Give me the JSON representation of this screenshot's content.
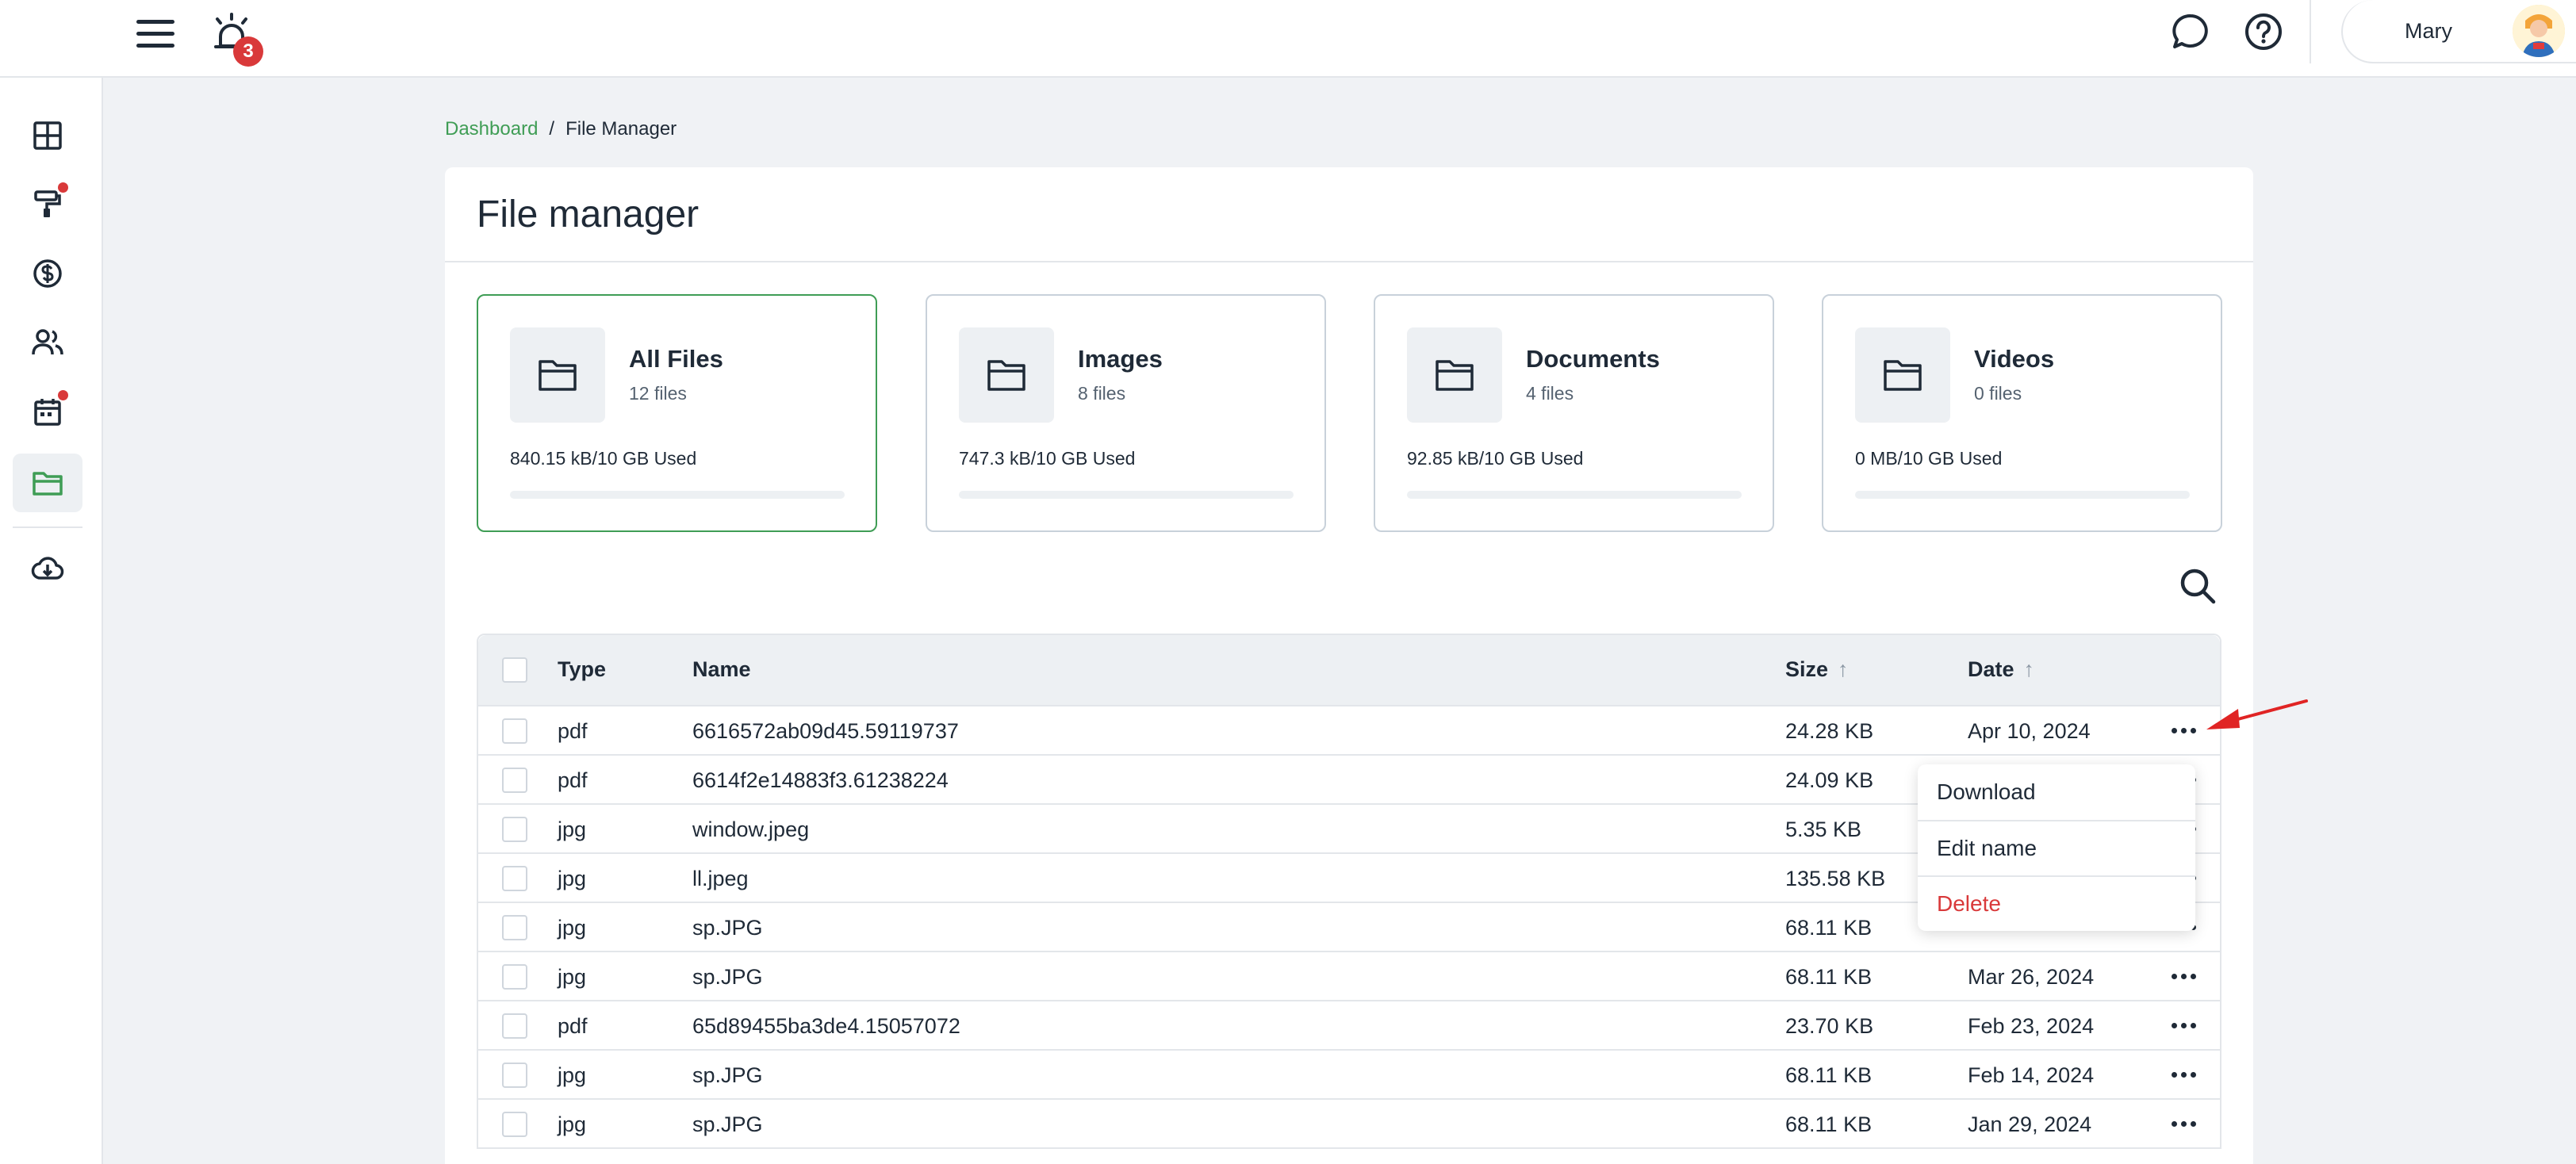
{
  "topbar": {
    "notification_count": "3",
    "user_name": "Mary",
    "icons": [
      "menu-icon",
      "alarm-icon",
      "chat-icon",
      "help-icon"
    ]
  },
  "sidebar": {
    "items": [
      {
        "icon": "dashboard-icon",
        "has_alert": false,
        "active": false
      },
      {
        "icon": "paint-roller-icon",
        "has_alert": true,
        "active": false
      },
      {
        "icon": "dollar-icon",
        "has_alert": false,
        "active": false
      },
      {
        "icon": "users-icon",
        "has_alert": false,
        "active": false
      },
      {
        "icon": "calendar-icon",
        "has_alert": true,
        "active": false
      },
      {
        "icon": "folder-icon",
        "has_alert": false,
        "active": true
      },
      {
        "icon": "cloud-download-icon",
        "has_alert": false,
        "active": false
      }
    ]
  },
  "breadcrumb": {
    "link": "Dashboard",
    "separator": "/",
    "current": "File Manager"
  },
  "page": {
    "title": "File manager"
  },
  "stats": [
    {
      "title": "All Files",
      "count": "12 files",
      "used": "840.15 kB/10 GB Used",
      "usage_fraction": 0.0
    },
    {
      "title": "Images",
      "count": "8 files",
      "used": "747.3 kB/10 GB Used",
      "usage_fraction": 0.0
    },
    {
      "title": "Documents",
      "count": "4 files",
      "used": "92.85 kB/10 GB Used",
      "usage_fraction": 0.0
    },
    {
      "title": "Videos",
      "count": "0 files",
      "used": "0 MB/10 GB Used",
      "usage_fraction": 0.0
    }
  ],
  "table": {
    "headers": {
      "type": "Type",
      "name": "Name",
      "size": "Size",
      "date": "Date"
    },
    "rows": [
      {
        "type": "pdf",
        "name": "6616572ab09d45.59119737",
        "size": "24.28 KB",
        "date": "Apr 10, 2024"
      },
      {
        "type": "pdf",
        "name": "6614f2e14883f3.61238224",
        "size": "24.09 KB",
        "date": ""
      },
      {
        "type": "jpg",
        "name": "window.jpeg",
        "size": "5.35 KB",
        "date": ""
      },
      {
        "type": "jpg",
        "name": "ll.jpeg",
        "size": "135.58 KB",
        "date": ""
      },
      {
        "type": "jpg",
        "name": "sp.JPG",
        "size": "68.11 KB",
        "date": ""
      },
      {
        "type": "jpg",
        "name": "sp.JPG",
        "size": "68.11 KB",
        "date": "Mar 26, 2024"
      },
      {
        "type": "pdf",
        "name": "65d89455ba3de4.15057072",
        "size": "23.70 KB",
        "date": "Feb 23, 2024"
      },
      {
        "type": "jpg",
        "name": "sp.JPG",
        "size": "68.11 KB",
        "date": "Feb 14, 2024"
      },
      {
        "type": "jpg",
        "name": "sp.JPG",
        "size": "68.11 KB",
        "date": "Jan 29, 2024"
      }
    ]
  },
  "row_menu": {
    "items": [
      "Download",
      "Edit name",
      "Delete"
    ]
  },
  "colors": {
    "accent": "#3f9d55",
    "danger": "#d9393a",
    "annotation_arrow": "#e02424"
  }
}
